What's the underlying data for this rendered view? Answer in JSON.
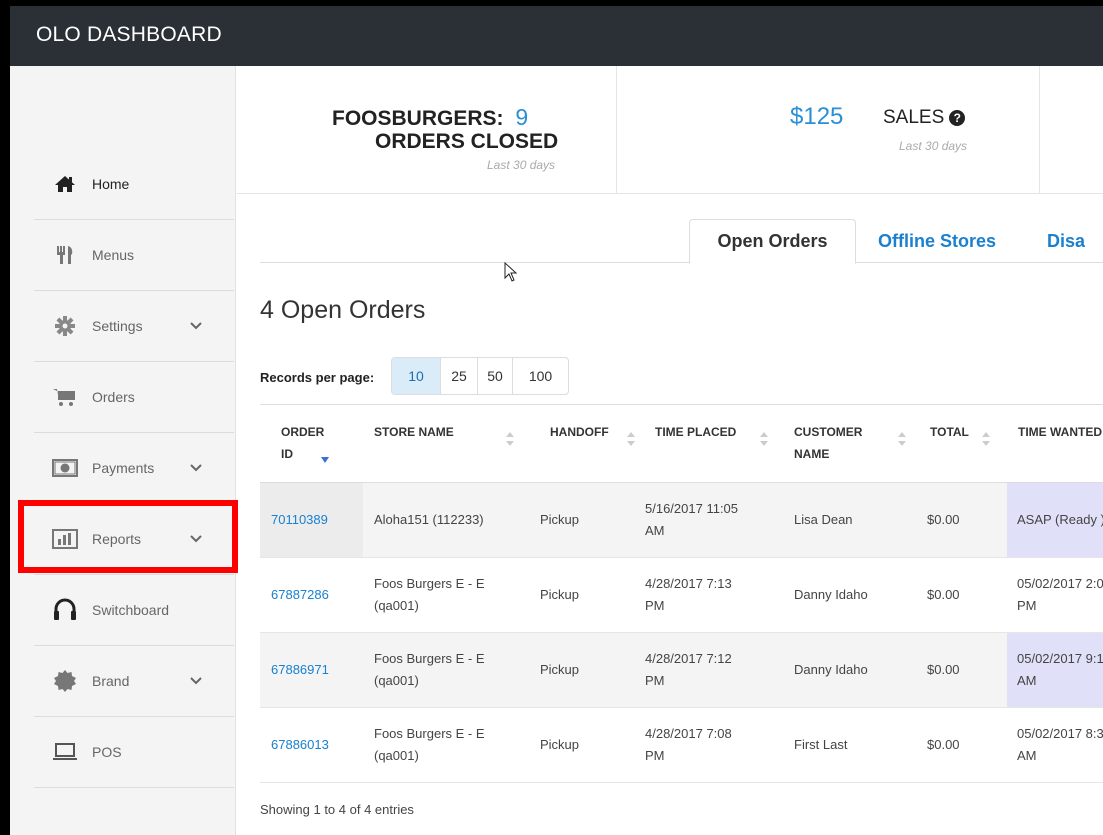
{
  "app": {
    "title": "OLO DASHBOARD"
  },
  "sidebar": {
    "items": [
      {
        "label": "Home",
        "icon": "home-icon",
        "active": true,
        "has_chevron": false
      },
      {
        "label": "Menus",
        "icon": "utensils-icon",
        "active": false,
        "has_chevron": false
      },
      {
        "label": "Settings",
        "icon": "gear-icon",
        "active": false,
        "has_chevron": true
      },
      {
        "label": "Orders",
        "icon": "cart-icon",
        "active": false,
        "has_chevron": false
      },
      {
        "label": "Payments",
        "icon": "money-icon",
        "active": false,
        "has_chevron": true
      },
      {
        "label": "Reports",
        "icon": "bar-chart-icon",
        "active": false,
        "has_chevron": true,
        "highlighted": true
      },
      {
        "label": "Switchboard",
        "icon": "headset-icon",
        "active": false,
        "has_chevron": false
      },
      {
        "label": "Brand",
        "icon": "badge-icon",
        "active": false,
        "has_chevron": true
      },
      {
        "label": "POS",
        "icon": "laptop-icon",
        "active": false,
        "has_chevron": false
      }
    ]
  },
  "stats": {
    "brand": "FOOSBURGERS:",
    "orders_count": "9",
    "orders_label": "ORDERS CLOSED",
    "orders_period": "Last 30 days",
    "sales_value": "$125",
    "sales_label": "SALES",
    "sales_period": "Last 30 days"
  },
  "tabs": [
    {
      "label": "Open Orders",
      "active": true
    },
    {
      "label": "Offline Stores",
      "active": false
    },
    {
      "label": "Disa",
      "active": false
    }
  ],
  "main": {
    "heading": "4 Open Orders",
    "records_label": "Records per page:",
    "page_sizes": [
      "10",
      "25",
      "50",
      "100"
    ],
    "selected_page_size": "10",
    "footer": "Showing 1 to 4 of 4 entries"
  },
  "table": {
    "headers": {
      "order_id_1": "ORDER",
      "order_id_2": "ID",
      "store": "STORE NAME",
      "handoff": "HANDOFF",
      "time_placed": "TIME PLACED",
      "customer_1": "CUSTOMER",
      "customer_2": "NAME",
      "total": "TOTAL",
      "time_wanted": "TIME WANTED"
    },
    "rows": [
      {
        "id": "70110389",
        "store_1": "Aloha151 (112233)",
        "store_2": "",
        "handoff": "Pickup",
        "placed_1": "5/16/2017 11:05",
        "placed_2": "AM",
        "customer": "Lisa Dean",
        "total": "$0.00",
        "wanted_1": "ASAP (Ready )",
        "wanted_2": ""
      },
      {
        "id": "67887286",
        "store_1": "Foos Burgers E - E",
        "store_2": "(qa001)",
        "handoff": "Pickup",
        "placed_1": "4/28/2017 7:13",
        "placed_2": "PM",
        "customer": "Danny Idaho",
        "total": "$0.00",
        "wanted_1": "05/02/2017 2:0",
        "wanted_2": "PM"
      },
      {
        "id": "67886971",
        "store_1": "Foos Burgers E - E",
        "store_2": "(qa001)",
        "handoff": "Pickup",
        "placed_1": "4/28/2017 7:12",
        "placed_2": "PM",
        "customer": "Danny Idaho",
        "total": "$0.00",
        "wanted_1": "05/02/2017 9:1",
        "wanted_2": "AM"
      },
      {
        "id": "67886013",
        "store_1": "Foos Burgers E - E",
        "store_2": "(qa001)",
        "handoff": "Pickup",
        "placed_1": "4/28/2017 7:08",
        "placed_2": "PM",
        "customer": "First Last",
        "total": "$0.00",
        "wanted_1": "05/02/2017 8:3",
        "wanted_2": "AM"
      }
    ]
  },
  "colors": {
    "topbar": "#2b3036",
    "link": "#1a80cf",
    "highlight": "#ff0000",
    "wanted_bg": "#e0e0f8"
  }
}
